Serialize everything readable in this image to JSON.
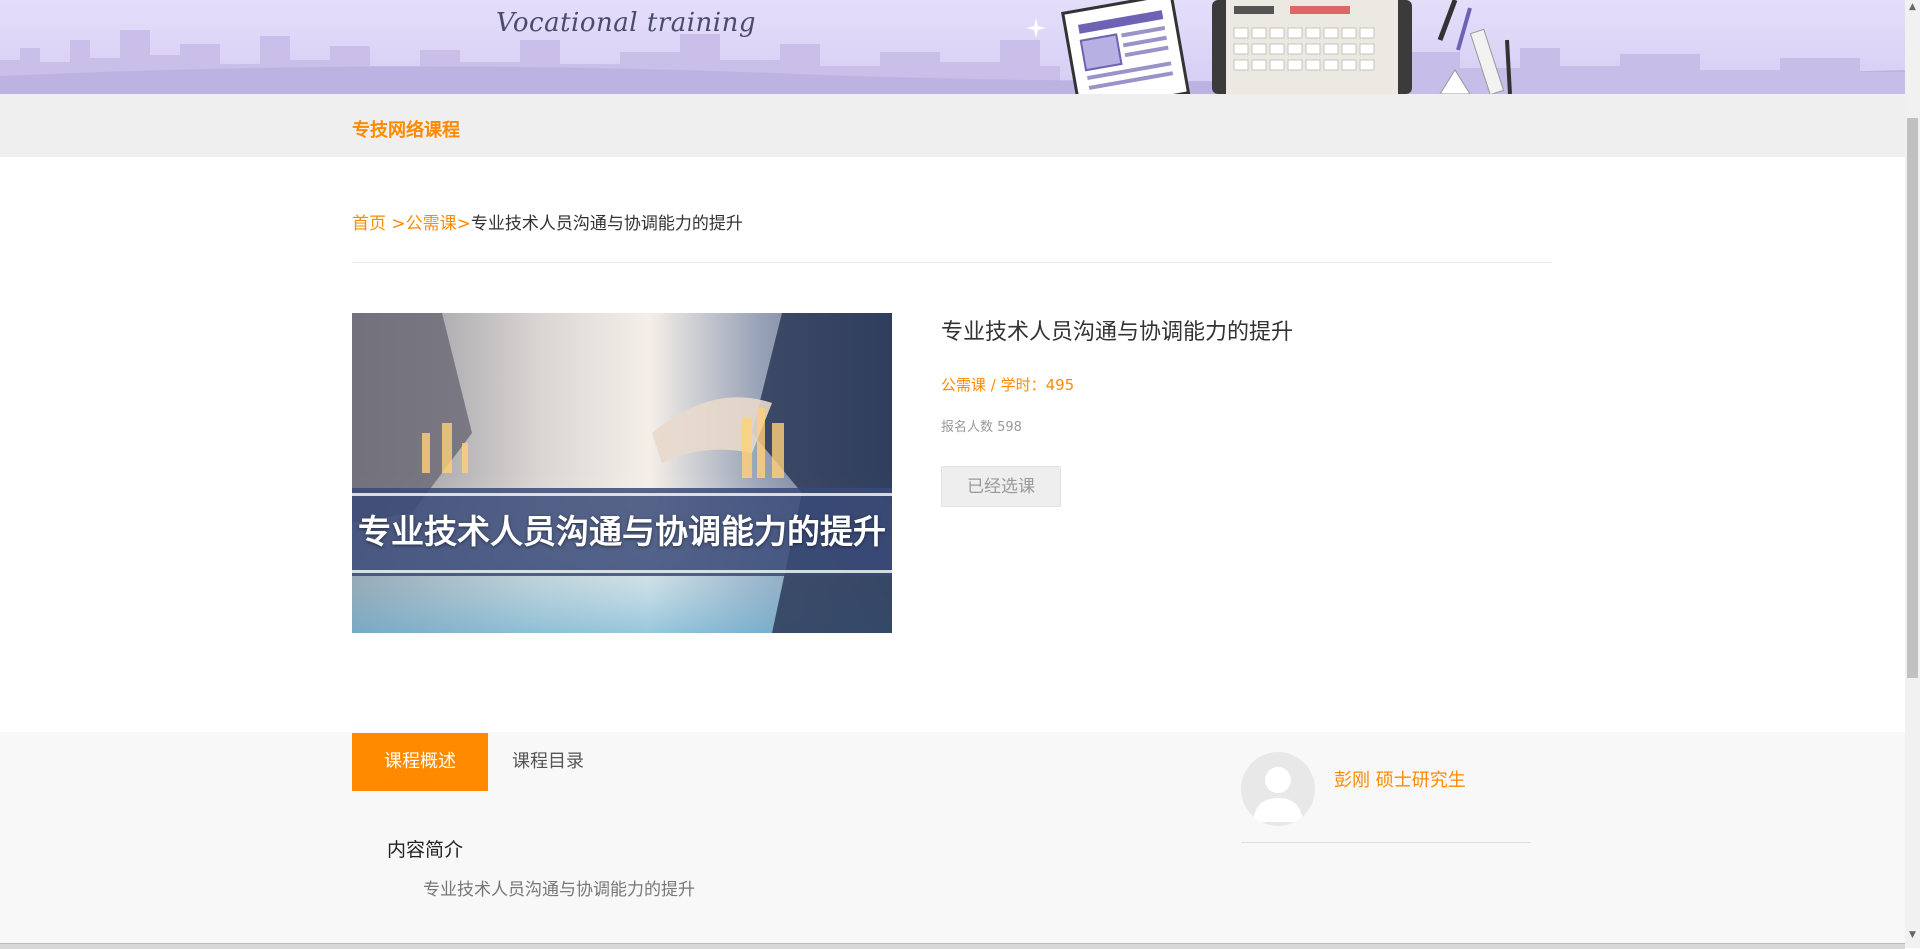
{
  "banner": {
    "subtitle": "Vocational training"
  },
  "nav": {
    "link_label": "专技网络课程"
  },
  "breadcrumb": {
    "home": "首页",
    "sep1": " >",
    "category": "公需课",
    "sep2": ">",
    "current": "专业技术人员沟通与协调能力的提升"
  },
  "course": {
    "cover_title": "专业技术人员沟通与协调能力的提升",
    "title": "专业技术人员沟通与协调能力的提升",
    "meta": "公需课 / 学时：495",
    "enroll": "报名人数 598",
    "enrolled_button": "已经选课"
  },
  "tabs": [
    {
      "label": "课程概述",
      "active": true
    },
    {
      "label": "课程目录",
      "active": false
    }
  ],
  "overview": {
    "heading": "内容简介",
    "body": "专业技术人员沟通与协调能力的提升"
  },
  "teacher": {
    "name": "彭刚 硕士研究生"
  },
  "colors": {
    "accent": "#ff8a00",
    "banner": "#d6cdf3",
    "nav_bg": "#efefef",
    "lower_bg": "#f8f8f8"
  },
  "icons": {
    "avatar": "user-silhouette-icon",
    "scroll_up": "scroll-up-arrow-icon",
    "scroll_down": "scroll-down-arrow-icon"
  }
}
